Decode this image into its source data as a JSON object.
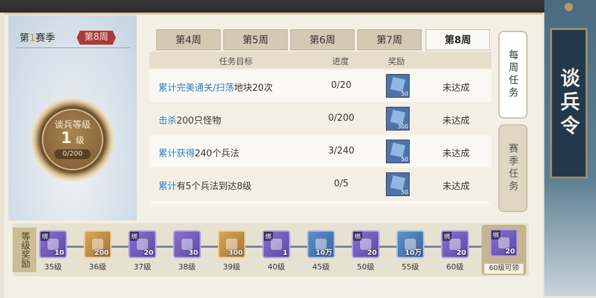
{
  "season": {
    "label_prefix": "第",
    "season_num": "1",
    "label_suffix": "赛季",
    "current_week": "第8周",
    "level_label": "谈兵等级",
    "level": "1",
    "level_unit": "级",
    "progress": "0/200"
  },
  "tabs": [
    {
      "label": "第4周",
      "active": false
    },
    {
      "label": "第5周",
      "active": false
    },
    {
      "label": "第6周",
      "active": false
    },
    {
      "label": "第7周",
      "active": false
    },
    {
      "label": "第8周",
      "active": true
    }
  ],
  "table": {
    "headers": {
      "goal": "任务目标",
      "progress": "进度",
      "reward": "奖励",
      "status": ""
    },
    "rows": [
      {
        "goal_a": "累计完美通关/扫荡",
        "goal_b": "地块20次",
        "progress": "0/20",
        "reward_qty": "50",
        "status": "未达成"
      },
      {
        "goal_a": "击杀",
        "goal_b": "200只怪物",
        "progress": "0/200",
        "reward_qty": "300",
        "status": "未达成"
      },
      {
        "goal_a": "累计获得",
        "goal_b": "240个兵法",
        "progress": "3/240",
        "reward_qty": "50",
        "status": "未达成"
      },
      {
        "goal_a": "累计",
        "goal_b": "有5个兵法到达8级",
        "progress": "0/5",
        "reward_qty": "50",
        "status": "未达成"
      }
    ]
  },
  "side_tabs": {
    "weekly": "每周任务",
    "season": "赛季任务"
  },
  "banner": "谈兵令",
  "rewards": {
    "label": "等级奖励",
    "bind_label": "绑",
    "items": [
      {
        "qty": "10",
        "level": "35级",
        "bound": true
      },
      {
        "qty": "200",
        "level": "36级",
        "bound": false
      },
      {
        "qty": "20",
        "level": "37级",
        "bound": true
      },
      {
        "qty": "30",
        "level": "38级",
        "bound": false
      },
      {
        "qty": "300",
        "level": "39级",
        "bound": false
      },
      {
        "qty": "1",
        "level": "40级",
        "bound": true
      },
      {
        "qty": "10万",
        "level": "45级",
        "bound": false
      },
      {
        "qty": "20",
        "level": "50级",
        "bound": true
      },
      {
        "qty": "10万",
        "level": "55级",
        "bound": false
      },
      {
        "qty": "20",
        "level": "60级",
        "bound": true
      }
    ],
    "final": {
      "qty": "20",
      "label": "60级可领"
    }
  }
}
